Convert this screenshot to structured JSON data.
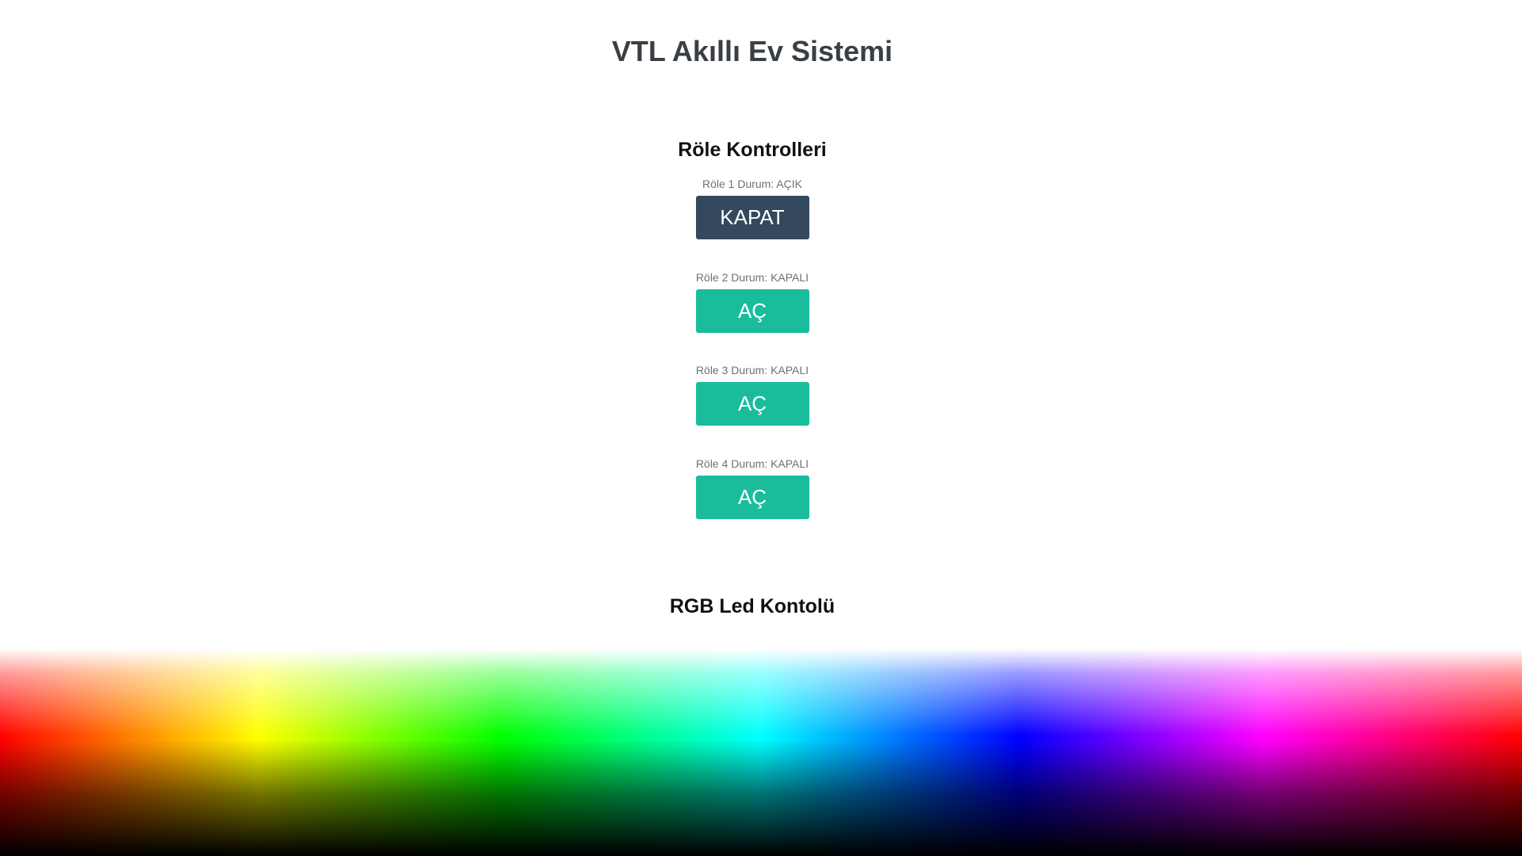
{
  "page": {
    "title": "VTL Akıllı Ev Sistemi"
  },
  "relays": {
    "section_title": "Röle Kontrolleri",
    "items": [
      {
        "status": "Röle 1 Durum: AÇIK",
        "button_label": "KAPAT",
        "state": "on"
      },
      {
        "status": "Röle 2 Durum: KAPALI",
        "button_label": "AÇ",
        "state": "off"
      },
      {
        "status": "Röle 3 Durum: KAPALI",
        "button_label": "AÇ",
        "state": "off"
      },
      {
        "status": "Röle 4 Durum: KAPALI",
        "button_label": "AÇ",
        "state": "off"
      }
    ]
  },
  "rgb": {
    "section_title": "RGB Led Kontolü"
  },
  "colors": {
    "button_off_action": "#34495e",
    "button_on_action": "#1abc9c",
    "title_text": "#3a3f45",
    "status_text": "#707070"
  }
}
